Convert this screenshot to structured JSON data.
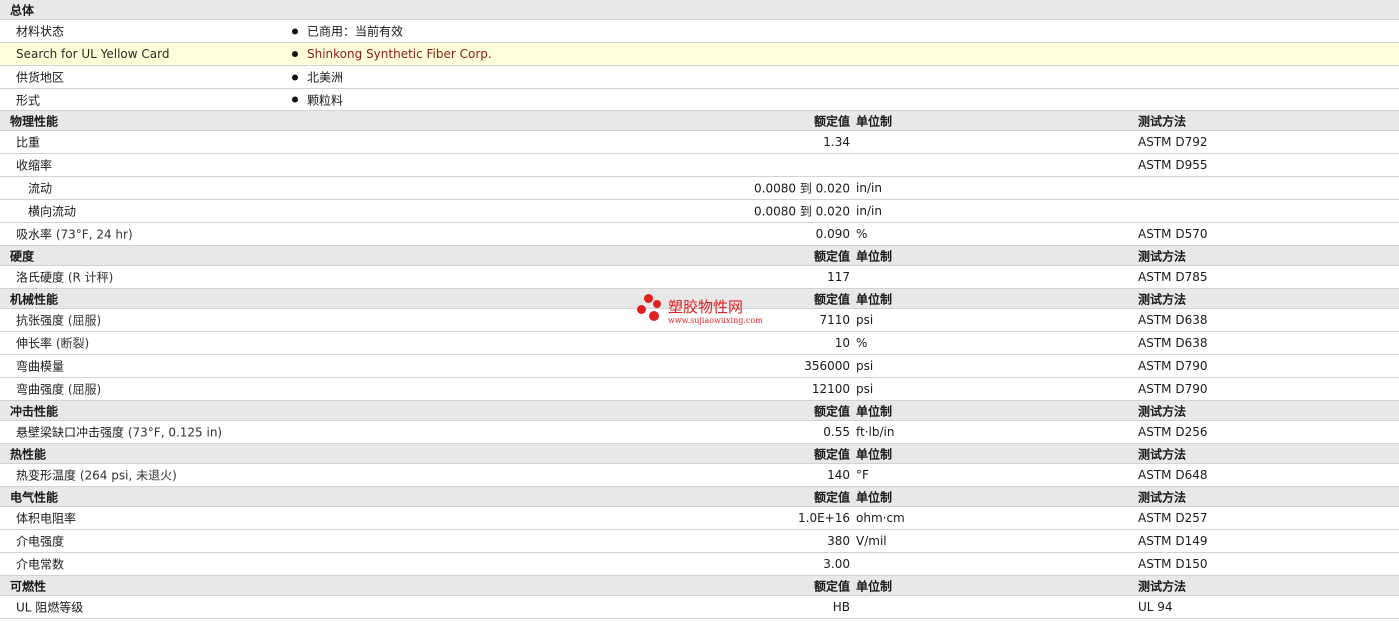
{
  "general": {
    "title": "总体",
    "rows": [
      {
        "label": "材料状态",
        "value": "已商用：当前有效"
      },
      {
        "label": "Search for UL Yellow Card",
        "value": "Shinkong Synthetic Fiber Corp."
      },
      {
        "label": "供货地区",
        "value": "北美洲"
      },
      {
        "label": "形式",
        "value": "颗粒料"
      }
    ]
  },
  "headers": {
    "nominal": "额定值",
    "unit": "单位制",
    "test": "测试方法"
  },
  "sections": [
    {
      "title": "物理性能",
      "rows": [
        {
          "label": "比重",
          "note": "",
          "value": "1.34",
          "unit": "",
          "test": "ASTM D792"
        },
        {
          "label": "收缩率",
          "note": "",
          "value": "",
          "unit": "",
          "test": "ASTM D955"
        },
        {
          "label": "流动",
          "note": "",
          "value": "0.0080 到  0.020",
          "unit": "in/in",
          "test": "",
          "sub": true
        },
        {
          "label": "横向流动",
          "note": "",
          "value": "0.0080 到  0.020",
          "unit": "in/in",
          "test": "",
          "sub": true
        },
        {
          "label": "吸水率",
          "note": "(73°F, 24 hr)",
          "value": "0.090",
          "unit": "%",
          "test": "ASTM D570"
        }
      ]
    },
    {
      "title": "硬度",
      "rows": [
        {
          "label": "洛氏硬度",
          "note": "(R 计秤)",
          "value": "117",
          "unit": "",
          "test": "ASTM D785"
        }
      ]
    },
    {
      "title": "机械性能",
      "rows": [
        {
          "label": "抗张强度",
          "note": "(屈服)",
          "value": "7110",
          "unit": "psi",
          "test": "ASTM D638"
        },
        {
          "label": "伸长率",
          "note": "(断裂)",
          "value": "10",
          "unit": "%",
          "test": "ASTM D638"
        },
        {
          "label": "弯曲模量",
          "note": "",
          "value": "356000",
          "unit": "psi",
          "test": "ASTM D790"
        },
        {
          "label": "弯曲强度",
          "note": "(屈服)",
          "value": "12100",
          "unit": "psi",
          "test": "ASTM D790"
        }
      ]
    },
    {
      "title": "冲击性能",
      "rows": [
        {
          "label": "悬壁梁缺口冲击强度",
          "note": "(73°F, 0.125 in)",
          "value": "0.55",
          "unit": "ft·lb/in",
          "test": "ASTM D256"
        }
      ]
    },
    {
      "title": "热性能",
      "rows": [
        {
          "label": "热变形温度",
          "note": "(264 psi, 未退火)",
          "value": "140",
          "unit": "°F",
          "test": "ASTM D648"
        }
      ]
    },
    {
      "title": "电气性能",
      "rows": [
        {
          "label": "体积电阻率",
          "note": "",
          "value": "1.0E+16",
          "unit": "ohm·cm",
          "test": "ASTM D257"
        },
        {
          "label": "介电强度",
          "note": "",
          "value": "380",
          "unit": "V/mil",
          "test": "ASTM D149"
        },
        {
          "label": "介电常数",
          "note": "",
          "value": "3.00",
          "unit": "",
          "test": "ASTM D150"
        }
      ]
    },
    {
      "title": "可燃性",
      "rows": [
        {
          "label": "UL 阻燃等级",
          "note": "",
          "value": "HB",
          "unit": "",
          "test": "UL 94"
        }
      ]
    }
  ],
  "watermark": {
    "title": "塑胶物性网",
    "url": "www.sujiaowuxing.com"
  },
  "colors": {
    "section_bg": "#e8e8e8",
    "highlight_bg": "#ffffd9",
    "link": "#8b1a1a",
    "watermark": "#e02020"
  }
}
